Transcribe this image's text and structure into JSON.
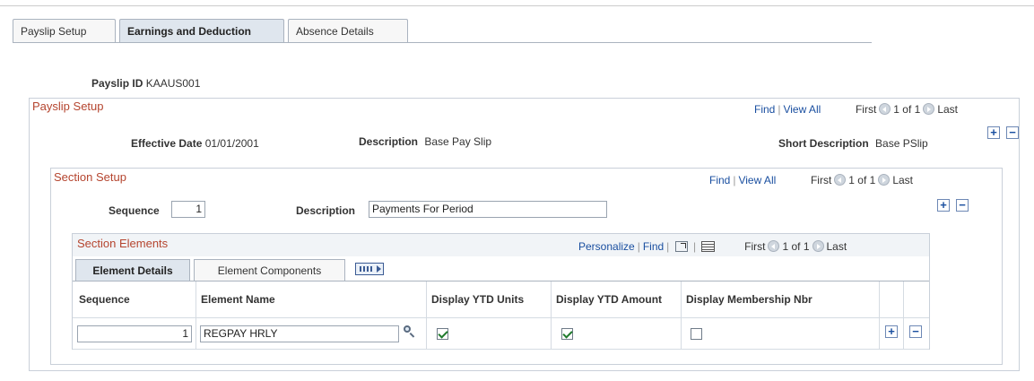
{
  "tabs": [
    {
      "label": "Payslip Setup",
      "active": false
    },
    {
      "label": "Earnings and Deduction",
      "active": true
    },
    {
      "label": "Absence Details",
      "active": false
    }
  ],
  "header": {
    "payslip_id_label": "Payslip ID",
    "payslip_id_value": "KAAUS001"
  },
  "payslip_setup": {
    "title": "Payslip Setup",
    "find": "Find",
    "view_all": "View All",
    "first": "First",
    "count": "1 of 1",
    "last": "Last",
    "effective_date_label": "Effective Date",
    "effective_date_value": "01/01/2001",
    "description_label": "Description",
    "description_value": "Base Pay Slip",
    "short_description_label": "Short Description",
    "short_description_value": "Base PSlip"
  },
  "section_setup": {
    "title": "Section Setup",
    "find": "Find",
    "view_all": "View All",
    "first": "First",
    "count": "1 of 1",
    "last": "Last",
    "sequence_label": "Sequence",
    "sequence_value": "1",
    "description_label": "Description",
    "description_value": "Payments For Period"
  },
  "section_elements": {
    "title": "Section Elements",
    "personalize": "Personalize",
    "find": "Find",
    "first": "First",
    "count": "1 of 1",
    "last": "Last",
    "tabs": [
      {
        "label": "Element Details",
        "active": true
      },
      {
        "label": "Element Components",
        "active": false
      }
    ],
    "columns": [
      "Sequence",
      "Element Name",
      "Display YTD Units",
      "Display YTD Amount",
      "Display Membership Nbr"
    ],
    "rows": [
      {
        "sequence": "1",
        "element_name": "REGPAY HRLY",
        "ytd_units": true,
        "ytd_amount": true,
        "membership_nbr": false
      }
    ]
  },
  "icons": {
    "prev": "previous-circle-icon",
    "next": "next-circle-icon",
    "add": "plus-icon",
    "delete": "minus-icon",
    "lookup": "magnifier-icon",
    "zoom": "zoom-icon",
    "grid": "grid-icon",
    "show_all_columns": "show-all-columns-icon"
  }
}
